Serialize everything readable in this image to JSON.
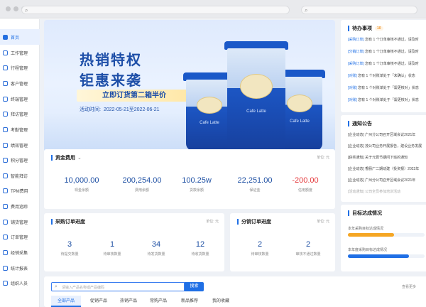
{
  "sidebar": {
    "items": [
      {
        "label": "首页",
        "active": true,
        "icon": "home-icon"
      },
      {
        "label": "工作管理",
        "icon": "work-icon"
      },
      {
        "label": "行程管理",
        "icon": "route-icon"
      },
      {
        "label": "客户管理",
        "icon": "customer-icon"
      },
      {
        "label": "终端管理",
        "icon": "terminal-icon"
      },
      {
        "label": "拜访管理",
        "icon": "visit-icon"
      },
      {
        "label": "考勤管理",
        "icon": "attendance-icon"
      },
      {
        "label": "绩效管理",
        "icon": "performance-icon"
      },
      {
        "label": "积分管理",
        "icon": "points-icon"
      },
      {
        "label": "智能拜访",
        "icon": "smart-visit-icon"
      },
      {
        "label": "TPM费用",
        "icon": "tpm-icon"
      },
      {
        "label": "费用追踪",
        "icon": "cost-track-icon"
      },
      {
        "label": "铺货管理",
        "icon": "distribution-icon"
      },
      {
        "label": "订单管理",
        "icon": "order-icon"
      },
      {
        "label": "经销采集",
        "icon": "dealer-icon"
      },
      {
        "label": "统计报表",
        "icon": "report-icon"
      },
      {
        "label": "组织人员",
        "icon": "org-icon"
      }
    ]
  },
  "banner": {
    "title_line1": "热销特权",
    "title_line2": "钜惠来袭",
    "promo": "立即订货第二箱半价",
    "date_prefix": "活动时间:",
    "date_range": "2022-05-21至2022-06-21",
    "product_brand": "Cafe Latte"
  },
  "funds": {
    "title": "资金费用",
    "unit": "单位: 元",
    "metrics": [
      {
        "value": "10,000.00",
        "label": "现金余额"
      },
      {
        "value": "200,254.00",
        "label": "费用余额"
      },
      {
        "value": "100.25w",
        "label": "货款余额"
      },
      {
        "value": "22,251.00",
        "label": "保证金"
      },
      {
        "value": "-200.00",
        "label": "信用额度",
        "negative": true
      }
    ]
  },
  "purchase": {
    "title": "采购订单进度",
    "unit": "单位: 元",
    "metrics": [
      {
        "value": "3",
        "label": "待提交数量"
      },
      {
        "value": "1",
        "label": "待审核数量"
      },
      {
        "value": "34",
        "label": "待发货数量"
      },
      {
        "value": "12",
        "label": "待收货数量"
      }
    ]
  },
  "distribution": {
    "title": "分销订单进度",
    "unit": "单位: 元",
    "metrics": [
      {
        "value": "2",
        "label": "待审核数量"
      },
      {
        "value": "2",
        "label": "审核不通过数量"
      }
    ]
  },
  "todo": {
    "title": "待办事项",
    "count": "10",
    "items": [
      {
        "tag": "[采购订单]",
        "text": "您有 1 个订单审核不通过，请及时"
      },
      {
        "tag": "[分销订单]",
        "text": "您有 1 个订单审核不通过，请及时"
      },
      {
        "tag": "[采购订单]",
        "text": "您有 1 个订单审核不通过，请及时"
      },
      {
        "tag": "[对账]",
        "text": "您有 1 个对账单处于「未确认」状态"
      },
      {
        "tag": "[对账]",
        "text": "您有 1 个对账单处于「需更核对」状态"
      },
      {
        "tag": "[对账]",
        "text": "您有 1 个对账单处于「需更核对」状态"
      }
    ]
  },
  "notice": {
    "title": "通知公告",
    "items": [
      "[企业动态] 广州分公司召开区域会议2021年",
      "[企业动态] 茂公司业务开展报告，建设业务发展",
      "[获奖通知] 关于元霄节期间下班的通知",
      "[企业动态] 香肠厂二期动建（投资报）2022年",
      "[企业动态] 广州分公司召开区域会议2021年",
      "[活动通知] 公司全员参加培训活动"
    ]
  },
  "goals": {
    "title": "目标达成情况",
    "items": [
      {
        "label": "本年采购目标达成情况",
        "progress": 0.6,
        "color": "#f5a623"
      },
      {
        "label": "本年度采购目标达成情况",
        "progress": 0.8,
        "color": "#1f6fe5"
      }
    ]
  },
  "search": {
    "placeholder": "请输入产品名称或产品编码",
    "button": "搜索",
    "more": "查看更多"
  },
  "categories": {
    "tabs": [
      {
        "label": "全部产品",
        "active": true
      },
      {
        "label": "促销产品"
      },
      {
        "label": "热销产品"
      },
      {
        "label": "常购产品"
      },
      {
        "label": "新品推荐"
      },
      {
        "label": "我的收藏"
      }
    ]
  }
}
